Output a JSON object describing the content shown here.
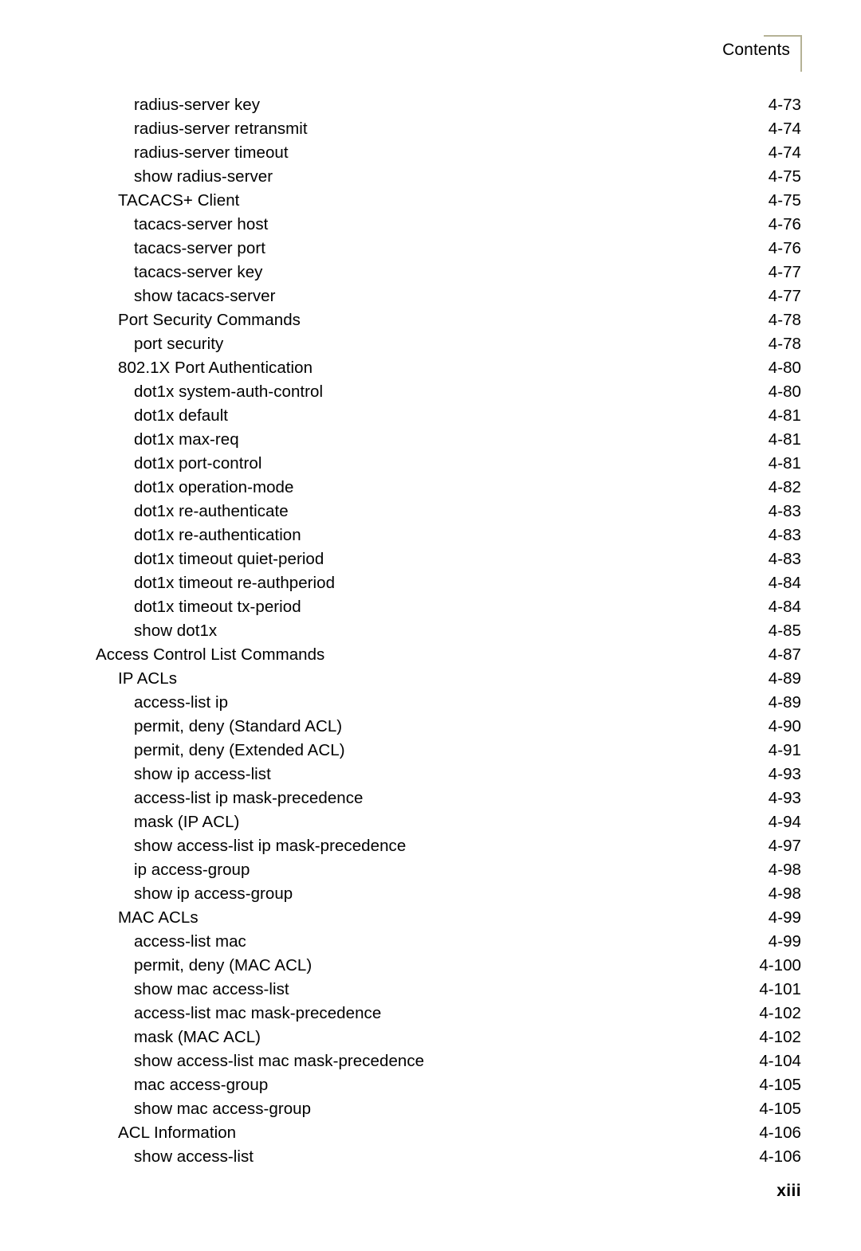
{
  "header": {
    "title": "Contents",
    "rule_color": "#b5b296"
  },
  "footer": {
    "folio": "xiii"
  },
  "toc": {
    "entries": [
      {
        "label": "radius-server key",
        "page": "4-73",
        "level": 2
      },
      {
        "label": "radius-server retransmit",
        "page": "4-74",
        "level": 2
      },
      {
        "label": "radius-server timeout",
        "page": "4-74",
        "level": 2
      },
      {
        "label": "show radius-server",
        "page": "4-75",
        "level": 2
      },
      {
        "label": "TACACS+ Client",
        "page": "4-75",
        "level": 1
      },
      {
        "label": "tacacs-server host",
        "page": "4-76",
        "level": 2
      },
      {
        "label": "tacacs-server port",
        "page": "4-76",
        "level": 2
      },
      {
        "label": "tacacs-server key",
        "page": "4-77",
        "level": 2
      },
      {
        "label": "show tacacs-server",
        "page": "4-77",
        "level": 2
      },
      {
        "label": "Port Security Commands",
        "page": "4-78",
        "level": 1
      },
      {
        "label": "port security",
        "page": "4-78",
        "level": 2
      },
      {
        "label": "802.1X Port Authentication",
        "page": "4-80",
        "level": 1
      },
      {
        "label": "dot1x system-auth-control",
        "page": "4-80",
        "level": 2
      },
      {
        "label": "dot1x default",
        "page": "4-81",
        "level": 2
      },
      {
        "label": "dot1x max-req",
        "page": "4-81",
        "level": 2
      },
      {
        "label": "dot1x port-control",
        "page": "4-81",
        "level": 2
      },
      {
        "label": "dot1x operation-mode",
        "page": "4-82",
        "level": 2
      },
      {
        "label": "dot1x re-authenticate",
        "page": "4-83",
        "level": 2
      },
      {
        "label": "dot1x re-authentication",
        "page": "4-83",
        "level": 2
      },
      {
        "label": "dot1x timeout quiet-period",
        "page": "4-83",
        "level": 2
      },
      {
        "label": "dot1x timeout re-authperiod",
        "page": "4-84",
        "level": 2
      },
      {
        "label": "dot1x timeout tx-period",
        "page": "4-84",
        "level": 2
      },
      {
        "label": "show dot1x",
        "page": "4-85",
        "level": 2
      },
      {
        "label": "Access Control List Commands",
        "page": "4-87",
        "level": 0
      },
      {
        "label": "IP ACLs",
        "page": "4-89",
        "level": 1
      },
      {
        "label": "access-list ip",
        "page": "4-89",
        "level": 2
      },
      {
        "label": "permit, deny (Standard ACL)",
        "page": "4-90",
        "level": 2
      },
      {
        "label": "permit, deny (Extended ACL)",
        "page": "4-91",
        "level": 2
      },
      {
        "label": "show ip access-list",
        "page": "4-93",
        "level": 2
      },
      {
        "label": "access-list ip mask-precedence",
        "page": "4-93",
        "level": 2
      },
      {
        "label": "mask (IP ACL)",
        "page": "4-94",
        "level": 2
      },
      {
        "label": "show access-list ip mask-precedence",
        "page": "4-97",
        "level": 2
      },
      {
        "label": "ip access-group",
        "page": "4-98",
        "level": 2
      },
      {
        "label": "show ip access-group",
        "page": "4-98",
        "level": 2
      },
      {
        "label": "MAC ACLs",
        "page": "4-99",
        "level": 1
      },
      {
        "label": "access-list mac",
        "page": "4-99",
        "level": 2
      },
      {
        "label": "permit, deny (MAC ACL)",
        "page": "4-100",
        "level": 2
      },
      {
        "label": "show mac access-list",
        "page": "4-101",
        "level": 2
      },
      {
        "label": "access-list mac mask-precedence",
        "page": "4-102",
        "level": 2
      },
      {
        "label": "mask (MAC ACL)",
        "page": "4-102",
        "level": 2
      },
      {
        "label": "show access-list mac mask-precedence",
        "page": "4-104",
        "level": 2
      },
      {
        "label": "mac access-group",
        "page": "4-105",
        "level": 2
      },
      {
        "label": "show mac access-group",
        "page": "4-105",
        "level": 2
      },
      {
        "label": "ACL Information",
        "page": "4-106",
        "level": 1
      },
      {
        "label": "show access-list",
        "page": "4-106",
        "level": 2
      }
    ]
  }
}
